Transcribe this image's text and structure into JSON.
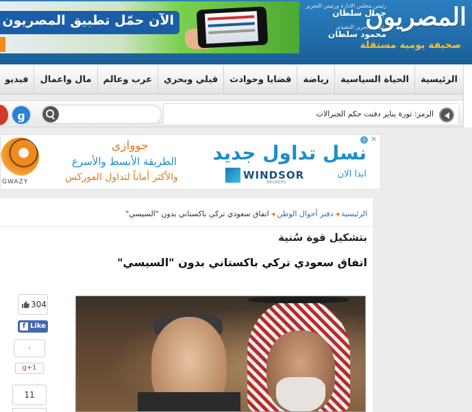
{
  "header": {
    "logo_text": "المصريون",
    "logo_tagline": "صحيفة يومية مستقلة",
    "editor_line1": "رئيس مجلس الادارة ورئيس التحرير",
    "editor_name1": "جمال سلطان",
    "editor_line2": "رئيس التحرير التنفيذي",
    "editor_name2": "محمود سلطان",
    "banner_text": "الآن حمّل تطبيق المصريون على"
  },
  "nav": {
    "items": [
      "الرئيسية",
      "الحياة السياسية",
      "رياضة",
      "قضايا وحوادث",
      "قبلي وبحري",
      "عرب وعالم",
      "مال واعمال",
      "فيديو"
    ]
  },
  "ticker": {
    "text": "الرمز: ثورة يناير دفنت حكم الجنرالات"
  },
  "social": {
    "gplus_glyph": "g"
  },
  "ad": {
    "headline": "نسل تداول جديد",
    "start_now": "ابدا الان",
    "brand": "WINDSOR",
    "brand_sub": "BROKERS",
    "right_title": "جووازى",
    "right_line2": "الطريقة الأبسط والأسرع",
    "right_line3": "والأكثر أماناً لتداول الفوركس",
    "right_brand": "GWAZY"
  },
  "breadcrumb": {
    "home": "الرئيسية",
    "section": "دفتر أحوال الوطن",
    "current": "اتفاق سعودي تركي باكستاني بدون \"السيسي\""
  },
  "article": {
    "kicker": "بتشكيل قوة سُنية",
    "title": "اتفاق سعودي تركي باكستاني بدون \"السيسي\""
  },
  "share": {
    "likes": "304",
    "fb_like_label": "Like",
    "gplus_count": "٠",
    "gplus_label": "g+1",
    "tweets": "11"
  },
  "colors": {
    "header_blue": "#1a5f98",
    "accent_orange": "#e27b1d",
    "link_blue": "#2a6bb3",
    "facebook_blue": "#4267b2"
  }
}
